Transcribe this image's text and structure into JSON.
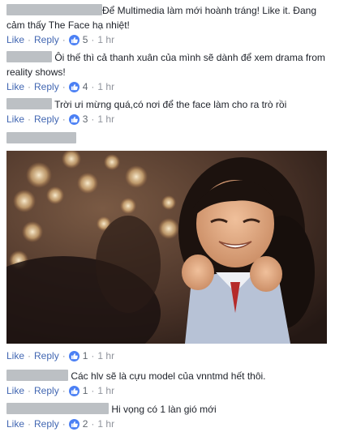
{
  "comments": [
    {
      "text": "Để Multimedia làm mới hoành tráng! Like it. Đang cảm thấy The Face hạ nhiệt!",
      "like": "Like",
      "reply": "Reply",
      "likes": "5",
      "time": "1 hr"
    },
    {
      "text": "Ôi thế thì cả thanh xuân của mình sẽ dành để xem drama from reality shows!",
      "like": "Like",
      "reply": "Reply",
      "likes": "4",
      "time": "1 hr"
    },
    {
      "text": "Trời ưi mừng quá,có nơi để the face làm cho ra trò rồi",
      "like": "Like",
      "reply": "Reply",
      "likes": "3",
      "time": "1 hr"
    },
    {
      "text": "",
      "like": "Like",
      "reply": "Reply",
      "likes": "1",
      "time": "1 hr"
    },
    {
      "text": "Các hlv sẽ là cựu model của vnntmd hết thôi.",
      "like": "Like",
      "reply": "Reply",
      "likes": "1",
      "time": "1 hr"
    },
    {
      "text": "Hi vọng có 1 làn gió mới",
      "like": "Like",
      "reply": "Reply",
      "likes": "2",
      "time": "1 hr"
    }
  ],
  "colors": {
    "link": "#4267b2",
    "like_badge": "#4b80f4",
    "name_blur": "#bcc0c4"
  }
}
